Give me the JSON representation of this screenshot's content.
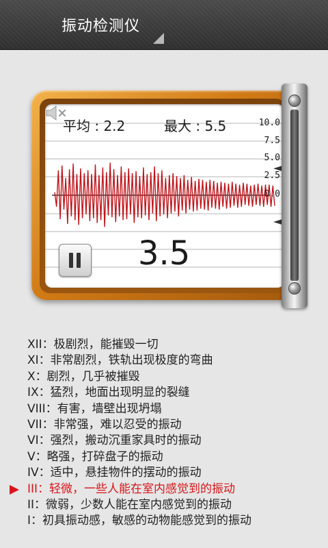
{
  "app": {
    "title": "振动检测仪"
  },
  "meter": {
    "avg_label": "平均 : ",
    "avg_value": "2.2",
    "max_label": "最大 : ",
    "max_value": "5.5",
    "scale_labels": [
      "10.0",
      "7.5",
      "5.0",
      "2.5",
      "0.0"
    ],
    "current_reading": "3.5",
    "pause_icon": "pause-icon",
    "mute_icon": "speaker-muted-icon",
    "trace_color": "#c0141b",
    "accent_color": "#d8151b",
    "waveform": [
      0.3,
      -1.2,
      2.6,
      -2.5,
      3.1,
      -1.5,
      1.8,
      -3.0,
      2.7,
      -2.2,
      3.3,
      -2.6,
      2.2,
      -3.1,
      2.8,
      -2.4,
      2.3,
      -2.0,
      2.6,
      -2.7,
      2.2,
      -2.4,
      3.2,
      -2.9,
      2.1,
      -2.6,
      2.9,
      -3.3,
      2.4,
      -2.1,
      3.4,
      -2.3,
      2.7,
      -2.8,
      2.1,
      -2.2,
      3.0,
      -2.6,
      2.4,
      -2.5,
      2.8,
      -2.0,
      2.3,
      -2.9,
      2.5,
      -2.3,
      2.0,
      -2.4,
      2.9,
      -2.1,
      2.2,
      -2.6,
      2.4,
      -1.9,
      3.0,
      -2.7,
      2.3,
      -2.2,
      2.6,
      -2.0,
      1.8,
      -2.4,
      2.1,
      -1.9,
      2.3,
      -1.7,
      2.0,
      -2.2,
      1.8,
      -1.6,
      2.1,
      -1.9,
      1.6,
      -1.5,
      1.9,
      -1.7,
      1.5,
      -1.6,
      1.7,
      -1.4,
      1.6,
      -1.5,
      1.4,
      -1.6,
      1.6,
      -1.3,
      1.5,
      -1.4,
      1.3,
      -1.5,
      1.4,
      -1.2,
      1.3,
      -1.4,
      1.2,
      -1.3,
      1.4,
      -1.1,
      1.2,
      -1.3,
      1.1,
      -1.2,
      1.3,
      -1.0,
      1.2,
      -1.1,
      1.0,
      -1.2,
      1.1,
      -1.0,
      1.2,
      -1.1,
      1.0,
      -1.2,
      1.1,
      -1.0,
      1.1,
      -1.2,
      1.0,
      -1.1
    ]
  },
  "scale_list": [
    {
      "text": "XII：极剧烈，能摧毁一切",
      "active": false
    },
    {
      "text": "XI：非常剧烈，铁轨出现极度的弯曲",
      "active": false
    },
    {
      "text": "X：剧烈，几乎被摧毁",
      "active": false
    },
    {
      "text": "IX：猛烈，地面出现明显的裂缝",
      "active": false
    },
    {
      "text": "VIII：有害，墙壁出现坍塌",
      "active": false
    },
    {
      "text": "VII：非常强，难以忍受的振动",
      "active": false
    },
    {
      "text": "VI：强烈，搬动沉重家具时的振动",
      "active": false
    },
    {
      "text": "V：略强，打碎盘子的振动",
      "active": false
    },
    {
      "text": "IV：适中，悬挂物件的摆动的振动",
      "active": false
    },
    {
      "text": "III：轻微，一些人能在室内感觉到的振动",
      "active": true
    },
    {
      "text": "II：微弱，少数人能在室内感觉到的振动",
      "active": false
    },
    {
      "text": "I：初具振动感，敏感的动物能感觉到的振动",
      "active": false
    }
  ]
}
